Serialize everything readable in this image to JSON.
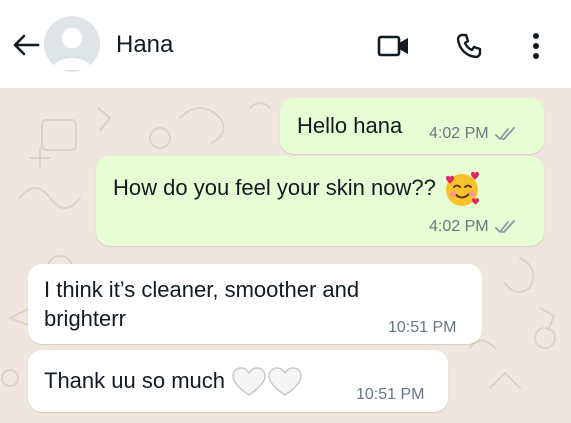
{
  "header": {
    "contact_name": "Hana",
    "icons": [
      "back-arrow-icon",
      "avatar-placeholder",
      "video-call-icon",
      "voice-call-icon",
      "more-options-icon"
    ]
  },
  "messages": [
    {
      "direction": "outgoing",
      "text": "Hello hana",
      "time": "4:02 PM",
      "status": "read"
    },
    {
      "direction": "outgoing",
      "text": "How do you feel your skin now??",
      "emoji": "smiling-face-with-hearts",
      "time": "4:02 PM",
      "status": "read"
    },
    {
      "direction": "incoming",
      "line1": "I think it’s cleaner, smoother and",
      "line2": "brighterr",
      "time": "10:51 PM"
    },
    {
      "direction": "incoming",
      "text": "Thank uu so much",
      "emoji": "white-heart x2",
      "time": "10:51 PM"
    }
  ],
  "colors": {
    "outgoing_bubble": "#e7fdd3",
    "incoming_bubble": "#ffffff",
    "wallpaper": "#efe7dd",
    "read_ticks": "#8e9aa0"
  }
}
